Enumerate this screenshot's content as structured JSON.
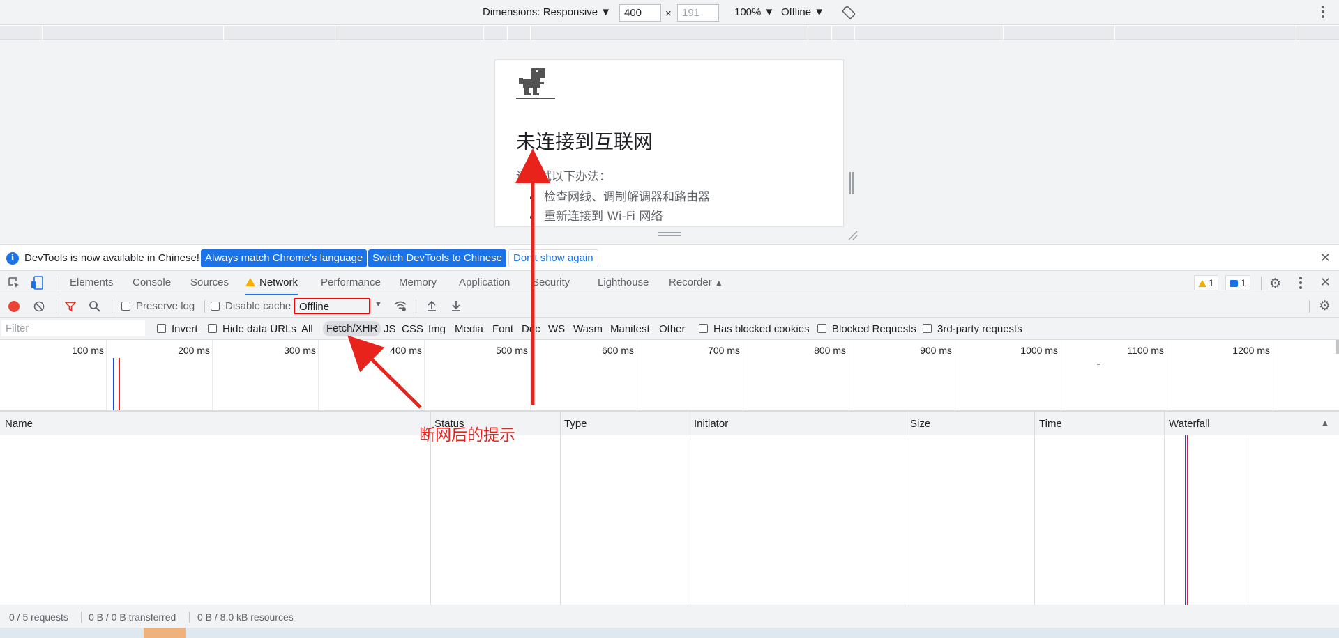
{
  "device_toolbar": {
    "dimensions_label": "Dimensions: Responsive ▼",
    "width_value": "400",
    "times": "×",
    "height_placeholder": "191",
    "zoom": "100% ▼",
    "throttle": "Offline ▼"
  },
  "offline_page": {
    "title": "未连接到互联网",
    "hint": "请尝试以下办法：",
    "suggestions": [
      "检查网线、调制解调器和路由器",
      "重新连接到 Wi-Fi 网络"
    ]
  },
  "infobar": {
    "text": "DevTools is now available in Chinese!",
    "btn_match": "Always match Chrome's language",
    "btn_switch": "Switch DevTools to Chinese",
    "btn_dont": "Don't show again",
    "close": "✕"
  },
  "tabs": [
    "Elements",
    "Console",
    "Sources",
    "Network",
    "Performance",
    "Memory",
    "Application",
    "Security",
    "Lighthouse",
    "Recorder"
  ],
  "badges": {
    "warnings": "1",
    "messages": "1"
  },
  "net_toolbar": {
    "preserve_log": "Preserve log",
    "disable_cache": "Disable cache",
    "throttling": "Offline"
  },
  "filter_bar": {
    "placeholder": "Filter",
    "invert": "Invert",
    "hide_data_urls": "Hide data URLs",
    "types": [
      "All",
      "Fetch/XHR",
      "JS",
      "CSS",
      "Img",
      "Media",
      "Font",
      "Doc",
      "WS",
      "Wasm",
      "Manifest",
      "Other"
    ],
    "has_blocked_cookies": "Has blocked cookies",
    "blocked_requests": "Blocked Requests",
    "third_party": "3rd-party requests"
  },
  "overview_ticks": [
    "100 ms",
    "200 ms",
    "300 ms",
    "400 ms",
    "500 ms",
    "600 ms",
    "700 ms",
    "800 ms",
    "900 ms",
    "1000 ms",
    "1100 ms",
    "1200 ms"
  ],
  "columns": [
    "Name",
    "Status",
    "Type",
    "Initiator",
    "Size",
    "Time",
    "Waterfall"
  ],
  "statusbar": {
    "requests": "0 / 5 requests",
    "transferred": "0 B / 0 B transferred",
    "resources": "0 B / 8.0 kB resources"
  },
  "annotation": {
    "text": "断网后的提示"
  },
  "colors": {
    "accent": "#1a73e8",
    "annotation": "#e8231b",
    "record": "#ea4335"
  }
}
